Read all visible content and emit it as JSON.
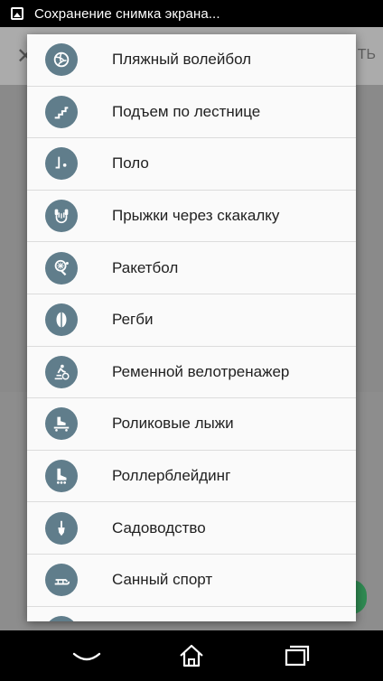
{
  "status_bar": {
    "text": "Сохранение снимка экрана..."
  },
  "background": {
    "close_glyph": "✕",
    "action_fragment": "ТЬ"
  },
  "dialog": {
    "items": [
      {
        "label": "Пляжный волейбол",
        "icon": "volleyball-icon"
      },
      {
        "label": "Подъем по лестнице",
        "icon": "stairs-icon"
      },
      {
        "label": "Поло",
        "icon": "polo-icon"
      },
      {
        "label": "Прыжки через скакалку",
        "icon": "jump-rope-icon"
      },
      {
        "label": "Ракетбол",
        "icon": "racket-icon"
      },
      {
        "label": "Регби",
        "icon": "rugby-ball-icon"
      },
      {
        "label": "Ременной велотренажер",
        "icon": "stationary-bike-icon"
      },
      {
        "label": "Роликовые лыжи",
        "icon": "roller-ski-icon"
      },
      {
        "label": "Роллерблейдинг",
        "icon": "inline-skate-icon"
      },
      {
        "label": "Садоводство",
        "icon": "gardening-icon"
      },
      {
        "label": "Санный спорт",
        "icon": "sled-icon"
      },
      {
        "label": "",
        "icon": "partial-icon"
      }
    ]
  },
  "nav_bar": {
    "buttons": [
      "back-icon",
      "home-icon",
      "recents-icon"
    ]
  },
  "colors": {
    "icon_circle": "#607d8b",
    "dialog_bg": "#fafafa",
    "divider": "#dcdcdc",
    "text": "#212121"
  }
}
